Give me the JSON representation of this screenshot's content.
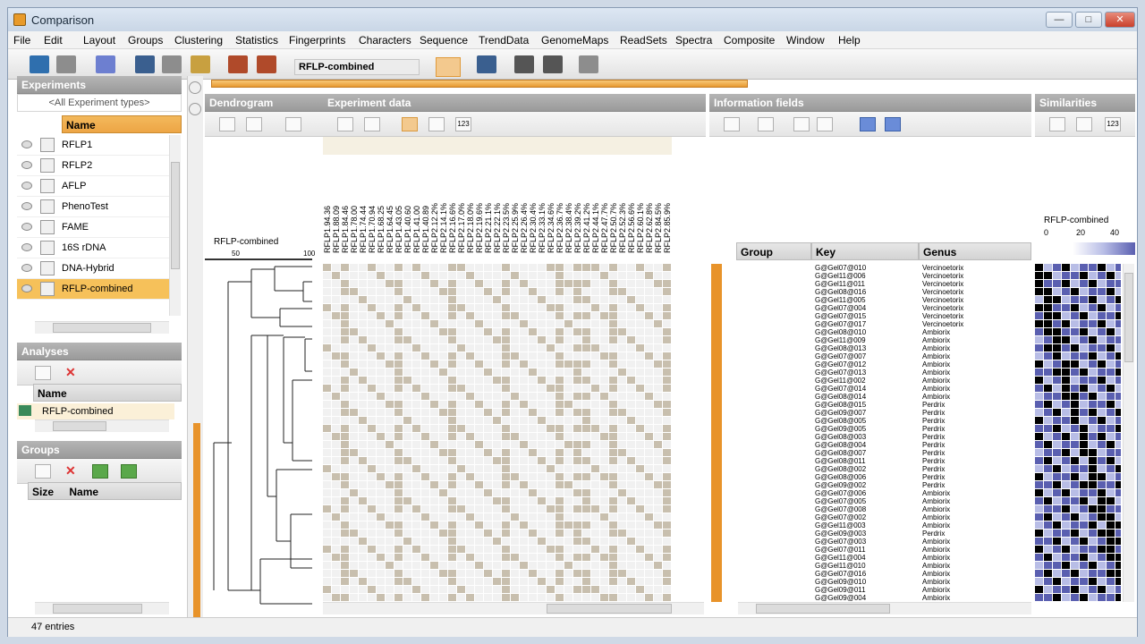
{
  "window": {
    "title": "Comparison"
  },
  "menu": [
    "File",
    "Edit",
    "Layout",
    "Groups",
    "Clustering",
    "Statistics",
    "Fingerprints",
    "Characters",
    "Sequence",
    "TrendData",
    "GenomeMaps",
    "ReadSets",
    "Spectra",
    "Composite",
    "Window",
    "Help"
  ],
  "toolbar": {
    "experiment_combo": "RFLP-combined"
  },
  "experiments": {
    "title": "Experiments",
    "filter": "<All Experiment types>",
    "col_name": "Name",
    "items": [
      "RFLP1",
      "RFLP2",
      "AFLP",
      "PhenoTest",
      "FAME",
      "16S rDNA",
      "DNA-Hybrid",
      "RFLP-combined"
    ],
    "selected_index": 7
  },
  "analyses": {
    "title": "Analyses",
    "col_name": "Name",
    "items": [
      "RFLP-combined"
    ]
  },
  "groups": {
    "title": "Groups",
    "col_size": "Size",
    "col_name": "Name"
  },
  "dendrogram": {
    "title": "Dendrogram",
    "label": "RFLP-combined",
    "scale_50": "50",
    "scale_100": "100"
  },
  "experiment_data": {
    "title": "Experiment data",
    "columns": [
      "RFLP1.94.36",
      "RFLP1.88.09",
      "RFLP1.84.46",
      "RFLP1.78.00",
      "RFLP1.74.44",
      "RFLP1.70.94",
      "RFLP1.68.25",
      "RFLP1.64.45",
      "RFLP1.43.05",
      "RFLP1.40.60",
      "RFLP1.41.00",
      "RFLP1.40.89",
      "RFLP2.12.2%",
      "RFLP2.14.1%",
      "RFLP2.16.6%",
      "RFLP2.17.0%",
      "RFLP2.18.0%",
      "RFLP2.19.6%",
      "RFLP2.21.1%",
      "RFLP2.22.1%",
      "RFLP2.23.5%",
      "RFLP2.25.9%",
      "RFLP2.26.4%",
      "RFLP2.30.4%",
      "RFLP2.33.1%",
      "RFLP2.34.6%",
      "RFLP2.36.7%",
      "RFLP2.38.4%",
      "RFLP2.39.2%",
      "RFLP2.41.2%",
      "RFLP2.44.1%",
      "RFLP2.47.7%",
      "RFLP2.50.7%",
      "RFLP2.52.3%",
      "RFLP2.56.6%",
      "RFLP2.60.1%",
      "RFLP2.62.8%",
      "RFLP2.84.5%",
      "RFLP2.85.9%"
    ]
  },
  "information_fields": {
    "title": "Information fields",
    "col_group": "Group",
    "col_key": "Key",
    "col_genus": "Genus",
    "rows": [
      [
        "G@Gel07@010",
        "Vercinoetorix"
      ],
      [
        "G@Gel11@006",
        "Vercinoetorix"
      ],
      [
        "G@Gel11@011",
        "Vercinoetorix"
      ],
      [
        "G@Gel08@016",
        "Vercinoetorix"
      ],
      [
        "G@Gel11@005",
        "Vercinoetorix"
      ],
      [
        "G@Gel07@004",
        "Vercinoetorix"
      ],
      [
        "G@Gel07@015",
        "Vercinoetorix"
      ],
      [
        "G@Gel07@017",
        "Vercinoetorix"
      ],
      [
        "G@Gel08@010",
        "Ambiorix"
      ],
      [
        "G@Gel11@009",
        "Ambiorix"
      ],
      [
        "G@Gel08@013",
        "Ambiorix"
      ],
      [
        "G@Gel07@007",
        "Ambiorix"
      ],
      [
        "G@Gel07@012",
        "Ambiorix"
      ],
      [
        "G@Gel07@013",
        "Ambiorix"
      ],
      [
        "G@Gel11@002",
        "Ambiorix"
      ],
      [
        "G@Gel07@014",
        "Ambiorix"
      ],
      [
        "G@Gel08@014",
        "Ambiorix"
      ],
      [
        "G@Gel08@015",
        "Perdrix"
      ],
      [
        "G@Gel09@007",
        "Perdrix"
      ],
      [
        "G@Gel08@005",
        "Perdrix"
      ],
      [
        "G@Gel09@005",
        "Perdrix"
      ],
      [
        "G@Gel08@003",
        "Perdrix"
      ],
      [
        "G@Gel08@004",
        "Perdrix"
      ],
      [
        "G@Gel08@007",
        "Perdrix"
      ],
      [
        "G@Gel08@011",
        "Perdrix"
      ],
      [
        "G@Gel08@002",
        "Perdrix"
      ],
      [
        "G@Gel08@006",
        "Perdrix"
      ],
      [
        "G@Gel09@002",
        "Perdrix"
      ],
      [
        "G@Gel07@006",
        "Ambiorix"
      ],
      [
        "G@Gel07@005",
        "Ambiorix"
      ],
      [
        "G@Gel07@008",
        "Ambiorix"
      ],
      [
        "G@Gel07@002",
        "Ambiorix"
      ],
      [
        "G@Gel11@003",
        "Ambiorix"
      ],
      [
        "G@Gel09@003",
        "Perdrix"
      ],
      [
        "G@Gel07@003",
        "Ambiorix"
      ],
      [
        "G@Gel07@011",
        "Ambiorix"
      ],
      [
        "G@Gel11@004",
        "Ambiorix"
      ],
      [
        "G@Gel11@010",
        "Ambiorix"
      ],
      [
        "G@Gel07@016",
        "Ambiorix"
      ],
      [
        "G@Gel09@010",
        "Ambiorix"
      ],
      [
        "G@Gel09@011",
        "Ambiorix"
      ],
      [
        "G@Gel09@004",
        "Ambiorix"
      ]
    ]
  },
  "similarities": {
    "title": "Similarities",
    "label": "RFLP-combined",
    "scale": [
      "0",
      "20",
      "40"
    ]
  },
  "status": {
    "entries": "47 entries"
  },
  "colors": {
    "accent": "#e8932a",
    "selection": "#f6c15a",
    "band": "#c8bfae",
    "sim_high": "#000000",
    "sim_mid": "#5a5fb0",
    "sim_low": "#b8bde6"
  }
}
